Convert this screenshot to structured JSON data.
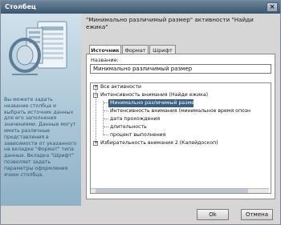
{
  "window": {
    "title": "Столбец",
    "close_glyph": "×"
  },
  "left_panel": {
    "help_text": "Вы можете задать название столбца и выбрать источник данных для его заполнения значениями. Данные могут иметь различные представления в зависимости от указанного на вкладке \"Формат\" типа данных. Вкладка \"Шрифт\" позволяет задать параметры оформления ячеек столбца."
  },
  "heading": {
    "line1": "\"Минимально различимый размер\"  активности \"Найди",
    "line2": "ежика\""
  },
  "tabs": [
    {
      "label": "Источник",
      "active": true
    },
    {
      "label": "Формат",
      "active": false
    },
    {
      "label": "Шрифт",
      "active": false
    }
  ],
  "name_field": {
    "label": "Название:",
    "value": "Минимально различимый размер"
  },
  "tree": {
    "items": [
      {
        "label": "Все активности",
        "level": 0,
        "expander": "+"
      },
      {
        "label": "Интенсивность внимания (Найди ежика)",
        "level": 0,
        "expander": "−"
      },
      {
        "label": "Минимально различимый размер",
        "level": 1,
        "selected": true
      },
      {
        "label": "Интенсивность внимания (минимальное время опозн",
        "level": 1
      },
      {
        "label": "дата прохождения",
        "level": 1
      },
      {
        "label": "длительность",
        "level": 1
      },
      {
        "label": "процент выполнения",
        "level": 1
      },
      {
        "label": "Избирательность внимания 2 (Калейдоскоп)",
        "level": 0,
        "expander": "+"
      }
    ]
  },
  "buttons": {
    "ok": "Ok",
    "cancel": "Отмена"
  },
  "colors": {
    "titlebar": "#3b546e",
    "selection": "#3a5f80",
    "panel_text": "#2d5673"
  },
  "icons": [
    "close-icon",
    "spreadsheet-illustration",
    "expand-icon",
    "collapse-icon"
  ]
}
